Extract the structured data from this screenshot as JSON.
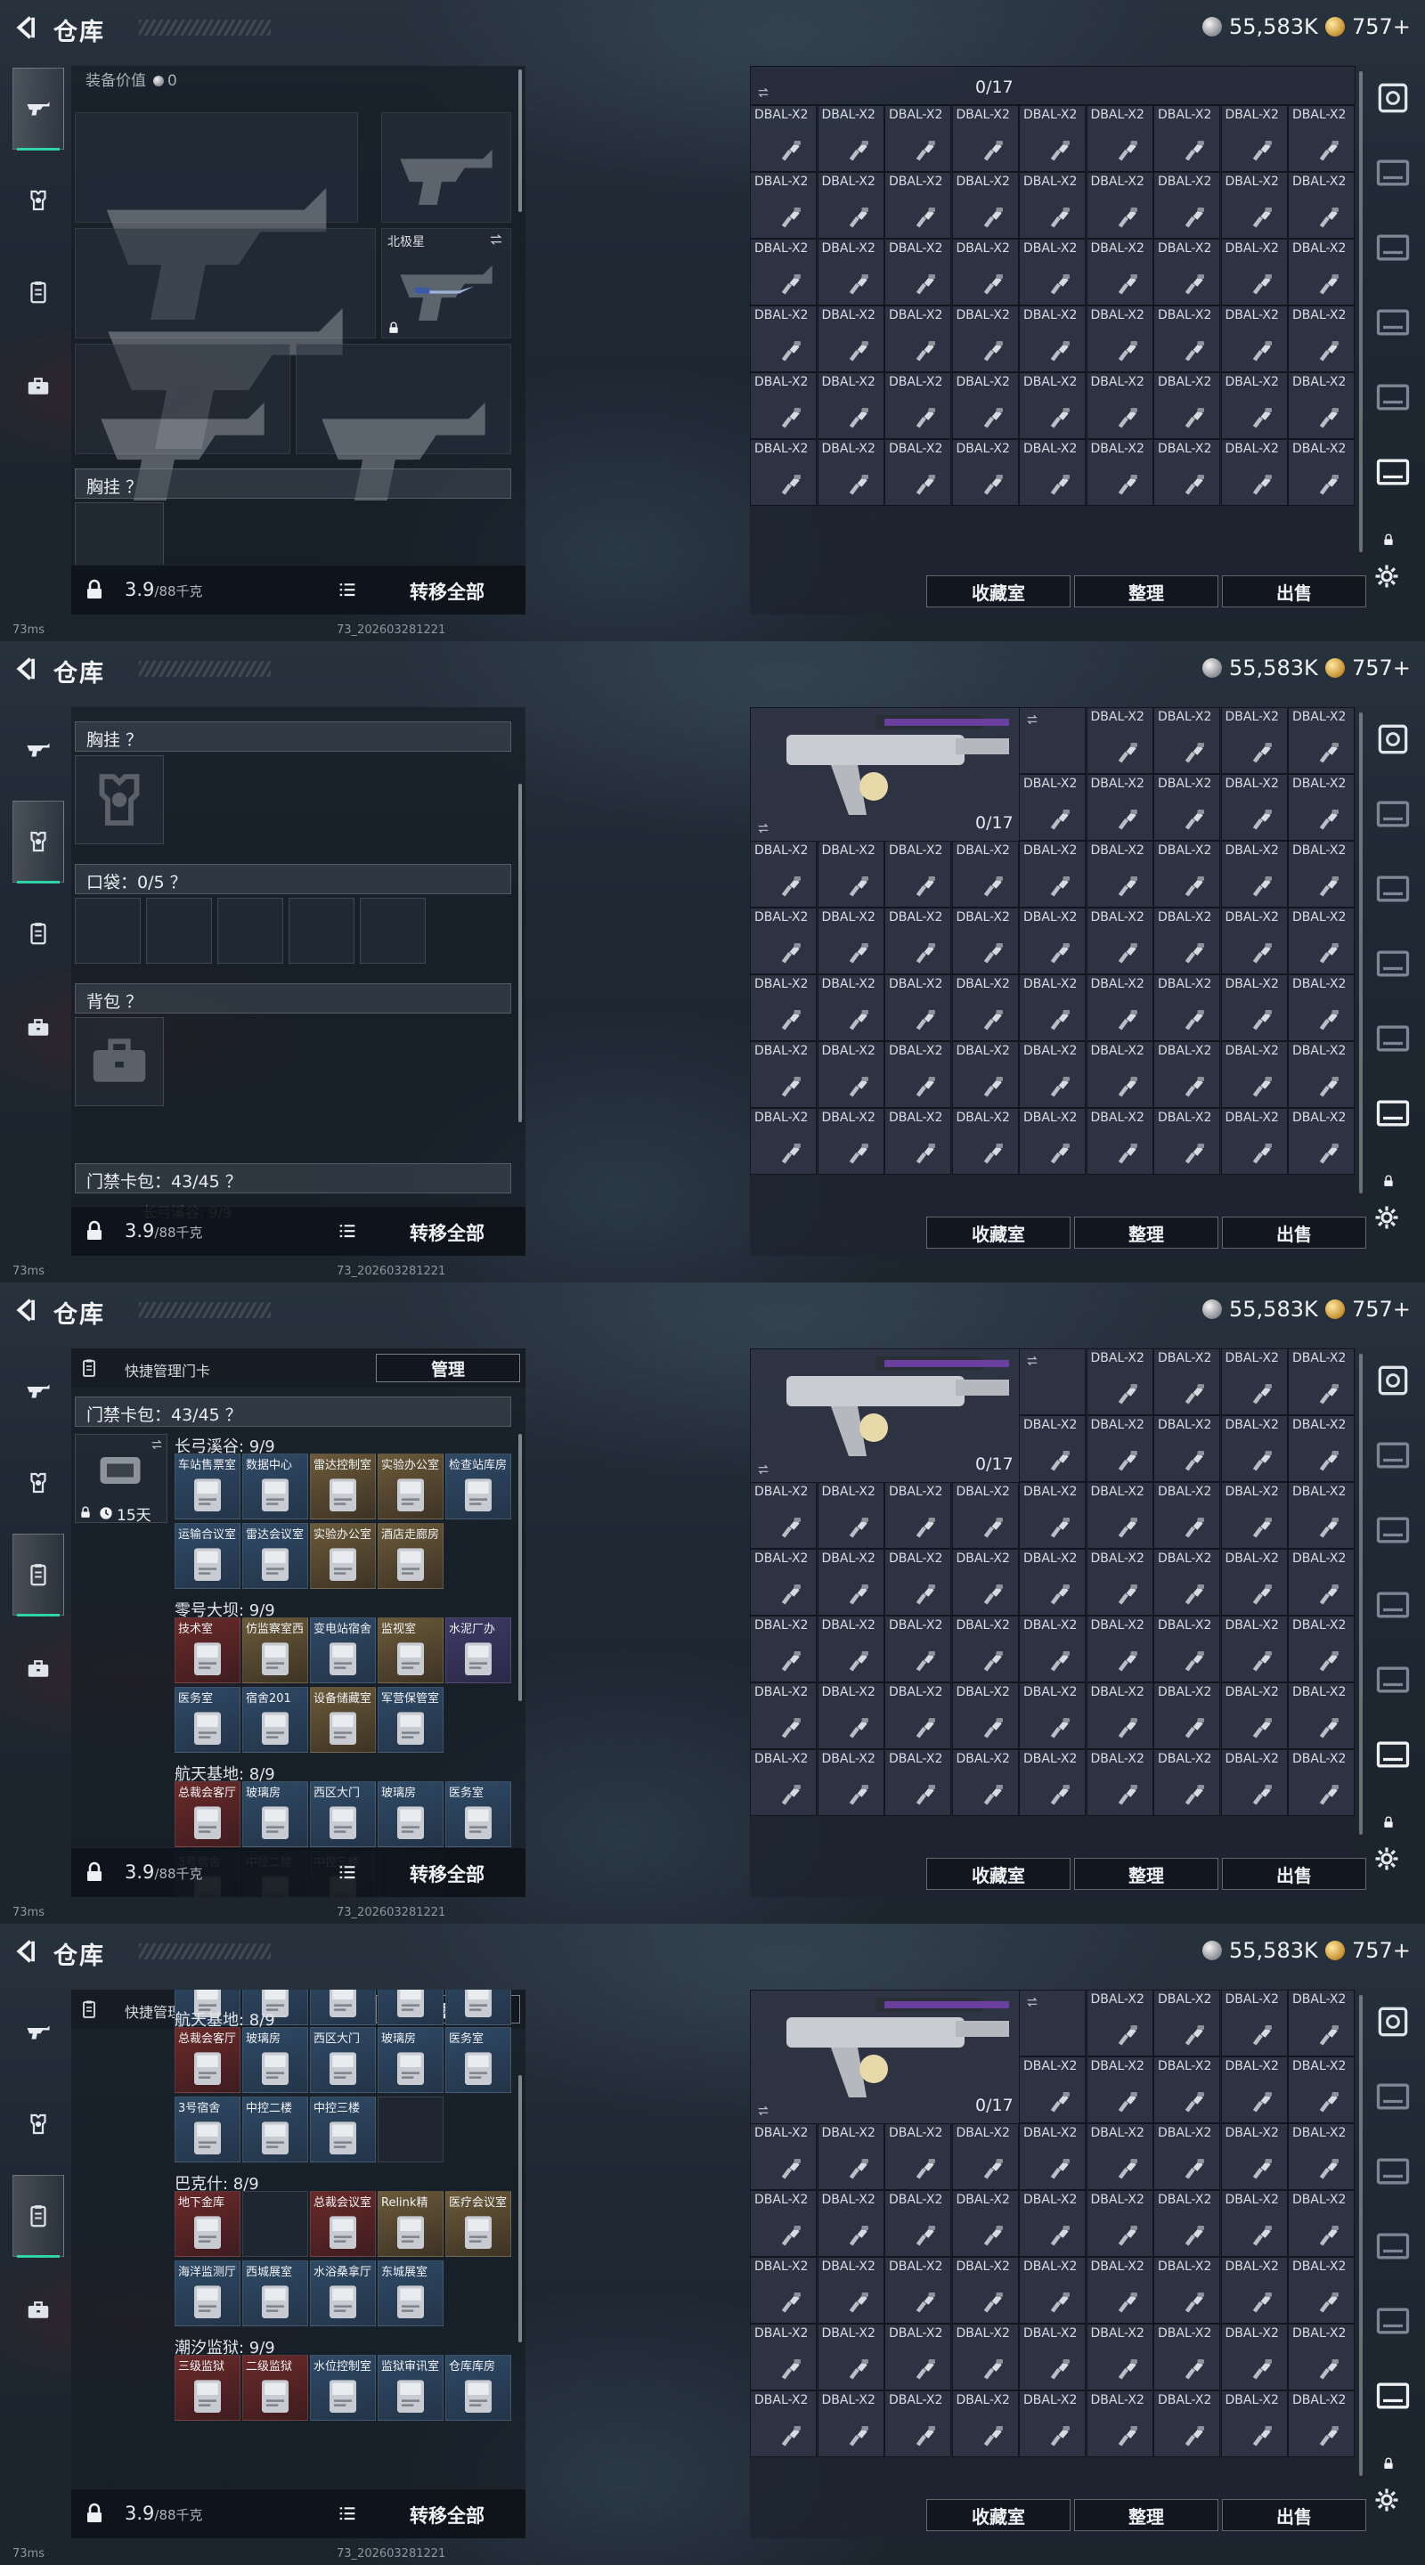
{
  "app": {
    "title": "仓库"
  },
  "currency": {
    "silver": "55,583K",
    "gold": "757+"
  },
  "footer": {
    "weight": "3.9",
    "weight_cap": "/88千克",
    "transfer_all": "转移全部"
  },
  "status": {
    "ping": "73ms",
    "build": "73_202603281221"
  },
  "loadout": {
    "equip_value_label": "装备价值",
    "equip_value": "0",
    "knife_name": "北极星",
    "chest_rig_label": "胸挂 ？",
    "pockets_label": "口袋：0/5 ？",
    "backpack_label": "背包 ？",
    "keycard_label": "门禁卡包：43/45 ？",
    "keycard_sub": "长弓溪谷: 9/9"
  },
  "keycards": {
    "header": "快捷管理门卡",
    "manage": "管理",
    "timer": "15天",
    "groups": [
      {
        "name": "长弓溪谷: 9/9",
        "cards": [
          {
            "label": "车站售票室",
            "rarity": "blue"
          },
          {
            "label": "数据中心",
            "rarity": "blue"
          },
          {
            "label": "雷达控制室",
            "rarity": "gold"
          },
          {
            "label": "实验办公室",
            "rarity": "gold"
          },
          {
            "label": "检查站库房",
            "rarity": "blue"
          },
          {
            "label": "运输合议室",
            "rarity": "blue"
          },
          {
            "label": "雷达会议室",
            "rarity": "blue"
          },
          {
            "label": "实验办公室",
            "rarity": "gold"
          },
          {
            "label": "酒店走廊房",
            "rarity": "gold"
          }
        ]
      },
      {
        "name": "零号大坝: 9/9",
        "cards": [
          {
            "label": "技术室",
            "rarity": "red"
          },
          {
            "label": "仿监察室西",
            "rarity": "gold"
          },
          {
            "label": "变电站宿舍",
            "rarity": "blue"
          },
          {
            "label": "监视室",
            "rarity": "gold"
          },
          {
            "label": "水泥厂办",
            "rarity": "purple"
          },
          {
            "label": "医务室",
            "rarity": "blue"
          },
          {
            "label": "宿舍201",
            "rarity": "blue"
          },
          {
            "label": "设备储藏室",
            "rarity": "gold"
          },
          {
            "label": "军营保管室",
            "rarity": "blue"
          }
        ]
      },
      {
        "name": "航天基地: 8/9",
        "cards": [
          {
            "label": "总裁会客厅",
            "rarity": "red"
          },
          {
            "label": "玻璃房",
            "rarity": "blue"
          },
          {
            "label": "西区大门",
            "rarity": "blue"
          },
          {
            "label": "玻璃房",
            "rarity": "blue"
          },
          {
            "label": "医务室",
            "rarity": "blue"
          },
          {
            "label": "3号宿舍",
            "rarity": "blue"
          },
          {
            "label": "中控二楼",
            "rarity": "blue"
          },
          {
            "label": "中控三楼",
            "rarity": "blue"
          },
          {
            "label": "",
            "rarity": "empty"
          }
        ]
      },
      {
        "name": "巴克什: 8/9",
        "cards": [
          {
            "label": "地下金库",
            "rarity": "red"
          },
          {
            "label": "",
            "rarity": "empty"
          },
          {
            "label": "总裁会议室",
            "rarity": "red"
          },
          {
            "label": "Relink精",
            "rarity": "gold"
          },
          {
            "label": "医疗会议室",
            "rarity": "gold"
          },
          {
            "label": "海洋监测厅",
            "rarity": "blue"
          },
          {
            "label": "西城展室",
            "rarity": "blue"
          },
          {
            "label": "水浴桑拿厅",
            "rarity": "blue"
          },
          {
            "label": "东城展室",
            "rarity": "blue"
          }
        ]
      },
      {
        "name": "潮汐监狱: 9/9",
        "cards": [
          {
            "label": "三级监狱",
            "rarity": "red"
          },
          {
            "label": "二级监狱",
            "rarity": "red"
          },
          {
            "label": "水位控制室",
            "rarity": "blue"
          },
          {
            "label": "监狱审讯室",
            "rarity": "blue"
          },
          {
            "label": "仓库库房",
            "rarity": "blue"
          }
        ]
      }
    ]
  },
  "stash": {
    "item_label": "DBAL-X2",
    "item_icon": "attachment-icon",
    "count": "0/17",
    "actions": [
      "收藏室",
      "整理",
      "出售"
    ]
  },
  "icons": {
    "accent": "#2fd3a6"
  }
}
